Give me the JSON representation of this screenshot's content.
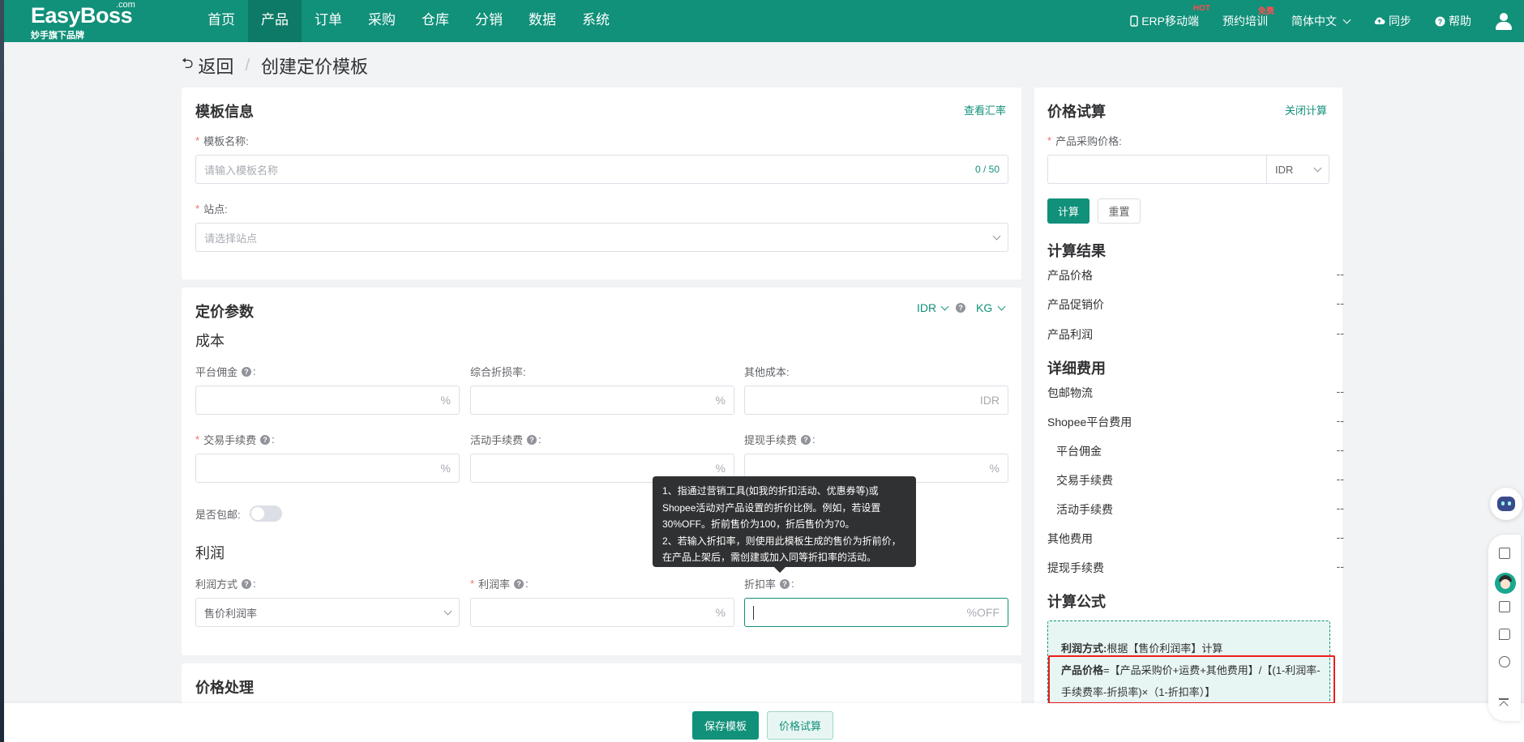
{
  "nav": {
    "logo": "EasyBoss",
    "logo_com": ".com",
    "logo_sub": "妙手旗下品牌",
    "menu": [
      "首页",
      "产品",
      "订单",
      "采购",
      "仓库",
      "分销",
      "数据",
      "系统"
    ],
    "active_menu": "产品",
    "erp_mobile": "ERP移动端",
    "erp_badge": "HOT",
    "training": "预约培训",
    "training_badge": "免费",
    "language": "简体中文",
    "sync": "同步",
    "help": "帮助"
  },
  "breadcrumb": {
    "back": "返回",
    "separator": "/",
    "current": "创建定价模板"
  },
  "template_info": {
    "title": "模板信息",
    "rate_link": "查看汇率",
    "name_label": "模板名称:",
    "name_placeholder": "请输入模板名称",
    "name_count": "0 / 50",
    "site_label": "站点:",
    "site_placeholder": "请选择站点"
  },
  "pricing": {
    "title": "定价参数",
    "currency": "IDR",
    "weight_unit": "KG",
    "cost_title": "成本",
    "platform_commission": "平台佣金",
    "loss_rate": "综合折损率:",
    "other_cost": "其他成本:",
    "transaction_fee": "交易手续费",
    "activity_fee": "活动手续费",
    "withdraw_fee": "提现手续费",
    "free_shipping": "是否包邮:",
    "profit_title": "利润",
    "profit_method_label": "利润方式",
    "profit_method_value": "售价利润率",
    "profit_rate": "利润率",
    "discount_rate": "折扣率",
    "colon": ":",
    "percent": "%",
    "idr": "IDR",
    "off_suffix": "%OFF",
    "price_handle_title": "价格处理"
  },
  "tooltip": {
    "lines": [
      "1、指通过营销工具(如我的折扣活动、优惠券等)或",
      "Shopee活动对产品设置的折价比例。例如，若设置",
      "30%OFF。折前售价为100，折后售价为70。",
      "2、若输入折扣率，则使用此模板生成的售价为折前价，",
      "在产品上架后，需创建或加入同等折扣率的活动。"
    ]
  },
  "calculator": {
    "title": "价格试算",
    "close_link": "关闭计算",
    "purchase_price_label": "产品采购价格:",
    "currency": "IDR",
    "calc_button": "计算",
    "reset_button": "重置",
    "result_title": "计算结果",
    "results": [
      {
        "k": "产品价格",
        "v": "--"
      },
      {
        "k": "产品促销价",
        "v": "--"
      },
      {
        "k": "产品利润",
        "v": "--"
      }
    ],
    "detail_title": "详细费用",
    "details": [
      {
        "k": "包邮物流",
        "v": "--"
      },
      {
        "k": "Shopee平台费用",
        "v": "--"
      },
      {
        "k": "平台佣金",
        "v": "--"
      },
      {
        "k": "交易手续费",
        "v": "--"
      },
      {
        "k": "活动手续费",
        "v": "--"
      },
      {
        "k": "其他费用",
        "v": "--"
      },
      {
        "k": "提现手续费",
        "v": "--"
      }
    ],
    "formula_title": "计算公式",
    "formula_method_bold": "利润方式:",
    "formula_method_text": "根据【售价利润率】计算",
    "formula_price_bold": "产品价格",
    "formula_price_text": "=【产品采购价+运费+其他费用】/【(1-利润率-手续费率-折损率)×（1-折扣率）】"
  },
  "footer": {
    "save_button": "保存模板",
    "trial_button": "价格试算"
  },
  "colors": {
    "brand": "#11907a",
    "highlight": "#ee1c1c"
  }
}
